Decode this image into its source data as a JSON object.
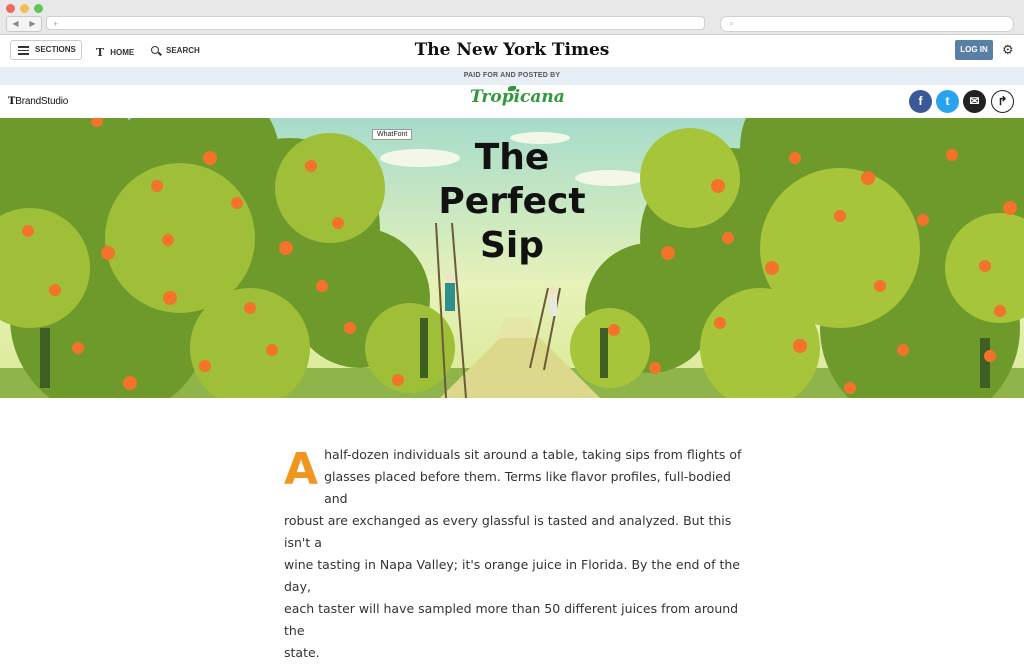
{
  "browser": {
    "back_icon": "◀",
    "forward_icon": "▶",
    "url_placeholder": "+",
    "search_icon": "⌕",
    "traffic_lights": [
      "#ee6a5e",
      "#f5bd4f",
      "#61c554"
    ]
  },
  "header": {
    "sections_label": "SECTIONS",
    "home_label": "HOME",
    "home_logo": "T",
    "search_label": "SEARCH",
    "masthead": "The New York Times",
    "login_label": "LOG IN",
    "settings_icon": "⚙"
  },
  "sponsor_bar": {
    "text": "PAID FOR AND POSTED BY"
  },
  "brand_bar": {
    "brandstudio_t": "T",
    "brandstudio_text": "BrandStudio",
    "sponsor_logo": "Tropicana",
    "social": [
      {
        "name": "facebook",
        "glyph": "f",
        "color": "#3b5998"
      },
      {
        "name": "twitter",
        "glyph": "t",
        "color": "#2aa3ef"
      },
      {
        "name": "email",
        "glyph": "✉",
        "color": "#222222"
      },
      {
        "name": "share",
        "glyph": "↱",
        "color": "#ffffff"
      }
    ]
  },
  "hero": {
    "whatfont_label": "WhatFont",
    "title_line1": "The",
    "title_line2": "Perfect",
    "title_line3": "Sip"
  },
  "article": {
    "drop_cap": "A",
    "lines": [
      "half-dozen individuals sit around a table, taking sips from flights of",
      "glasses placed before them. Terms like flavor profiles, full-bodied and",
      "robust are exchanged as every glassful is tasted and analyzed. But this isn't a",
      "wine tasting in Napa Valley; it's orange juice in Florida. By the end of the day,",
      "each taster will have sampled more than 50 different juices from around the",
      "state."
    ]
  }
}
